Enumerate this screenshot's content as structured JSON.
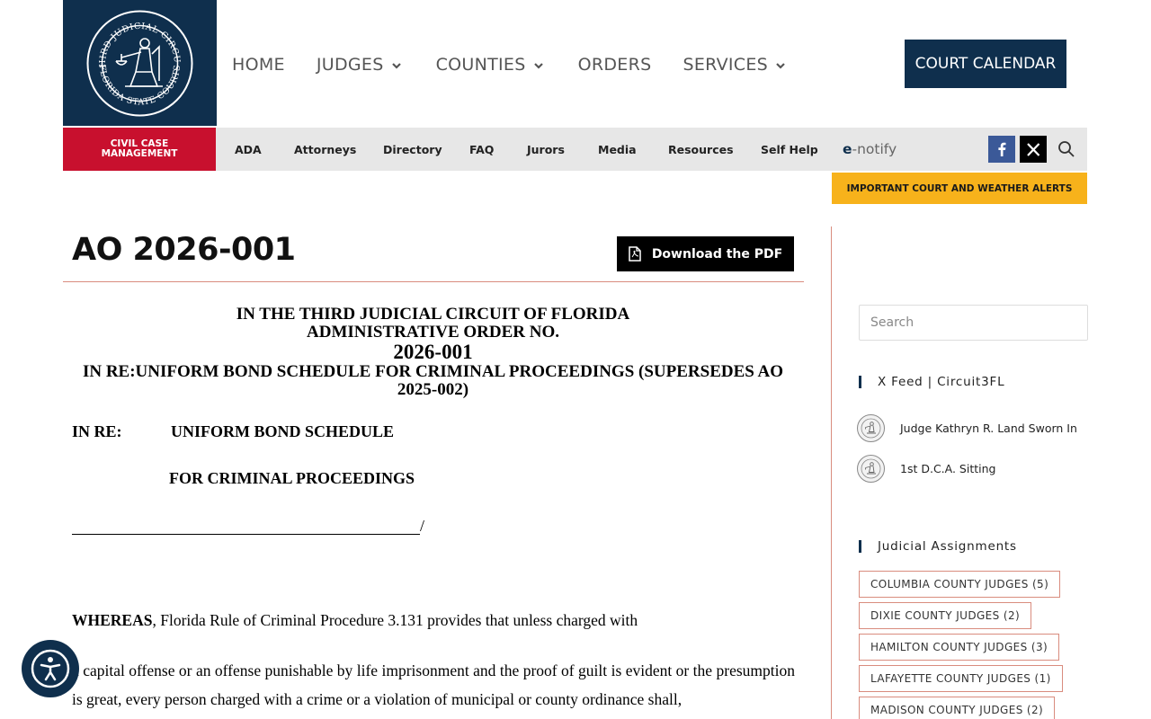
{
  "header": {
    "logo_text": "THIRD JUDICIAL CIRCUIT · FLORIDA STATE COURTS",
    "nav": [
      {
        "label": "HOME",
        "has_dropdown": false
      },
      {
        "label": "JUDGES",
        "has_dropdown": true
      },
      {
        "label": "COUNTIES",
        "has_dropdown": true
      },
      {
        "label": "ORDERS",
        "has_dropdown": false
      },
      {
        "label": "SERVICES",
        "has_dropdown": true
      }
    ],
    "court_calendar": "COURT CALENDAR"
  },
  "subnav": {
    "civil_case": "CIVIL CASE MANAGEMENT",
    "links": [
      "ADA",
      "Attorneys",
      "Directory",
      "FAQ",
      "Jurors",
      "Media",
      "Resources",
      "Self Help"
    ],
    "enotify_e": "e",
    "enotify_rest": "-notify",
    "social_icons": [
      "facebook-icon",
      "x-twitter-icon",
      "search-icon"
    ],
    "alerts": "IMPORTANT COURT AND WEATHER ALERTS"
  },
  "article": {
    "title": "AO 2026-001",
    "download": "Download the PDF",
    "doc": {
      "heading_1": "IN THE THIRD JUDICIAL CIRCUIT OF FLORIDA",
      "heading_2": "ADMINISTRATIVE ORDER NO.",
      "heading_3": "2026-001",
      "heading_4": "IN RE:UNIFORM BOND SCHEDULE FOR CRIMINAL PROCEEDINGS (SUPERSEDES AO 2025-002)",
      "inre_label": "IN RE:",
      "inre_line1": "UNIFORM BOND SCHEDULE",
      "inre_line2": "FOR CRIMINAL PROCEEDINGS",
      "slash": "/",
      "whereas_bold": "WHEREAS",
      "whereas_text": ", Florida Rule of Criminal Procedure 3.131 provides that unless charged with",
      "paragraph": "a capital offense or an offense punishable by life imprisonment and the proof of guilt is evident or the presumption is great, every person charged with a crime or a violation of municipal or county ordinance shall,"
    }
  },
  "sidebar": {
    "search_placeholder": "Search",
    "feed_heading": "X Feed | Circuit3FL",
    "feed": [
      "Judge Kathryn R. Land Sworn In",
      "1st D.C.A. Sitting"
    ],
    "assignments_heading": "Judicial Assignments",
    "assignments": [
      "COLUMBIA COUNTY JUDGES (5)",
      "DIXIE COUNTY JUDGES (2)",
      "HAMILTON COUNTY JUDGES (3)",
      "LAFAYETTE COUNTY JUDGES (1)",
      "MADISON COUNTY JUDGES (2)"
    ]
  },
  "colors": {
    "navy": "#0f2f4d",
    "red": "#c8102e",
    "alert_yellow": "#f7b21b",
    "rule": "#d98c7e"
  }
}
